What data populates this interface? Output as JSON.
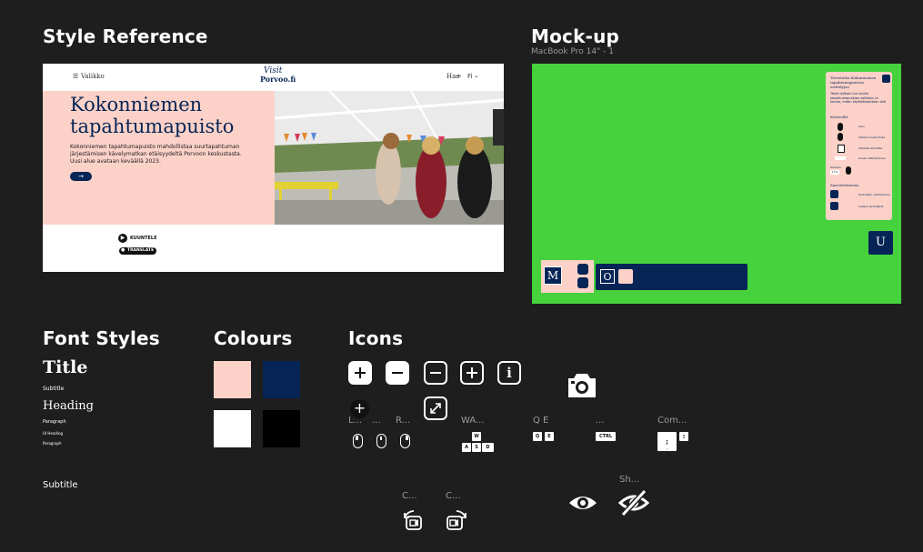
{
  "headings": {
    "style_reference": "Style Reference",
    "mockup": "Mock-up",
    "mockup_frame": "MacBook Pro 14\" - 1",
    "font_styles": "Font Styles",
    "colours": "Colours",
    "icons": "Icons"
  },
  "reference": {
    "menu_label": "Valikko",
    "logo_line1": "Visit",
    "logo_line2": "Porvoo.fi",
    "search_label": "Hae",
    "lang_label": "Fi",
    "hero_title_line1": "Kokonniemen",
    "hero_title_line2": "tapahtumapuisto",
    "hero_body": "Kokonniemen tapahtumapuisto mahdollistaa suurtapahtuman järjestämisen kävelymatkan etäisyydeltä Porvoon keskustasta. Uusi alue avataan keväällä 2023.",
    "listen_label": "KUUNTELE",
    "translate_label": "TRANSLATE"
  },
  "mockup": {
    "panel_title": "Tervetuloa Kokonniemen tapahtumapuiston esittelyyn!",
    "panel_body": "Tämä työkalu luo sinulle tapahtumapuiston esittelyn ja kertoo, miten käyttöönotetaan sitä",
    "section_controls": "Kontrollit",
    "control_rows": [
      "Liiku",
      "Vaihda kuvakulmaa",
      "Lähestä kohdetta",
      "Kuvan kääntyminen",
      "Kamera"
    ],
    "zoom_value": "17%",
    "section_access": "Saavutettavuus",
    "access_rows": [
      "Kontrastin vaihtaminen",
      "Lisätyt värimäärät"
    ],
    "button_m": "M",
    "button_o": "O",
    "button_u": "U"
  },
  "font_styles": {
    "title": "Title",
    "subtitle": "Subtitle",
    "heading": "Heading",
    "paragraph": "Paragraph",
    "ui_heading": "UI Heading",
    "paragraph_small": "Paragraph",
    "subtitle_large": "Subtitle"
  },
  "colours": {
    "swatches": [
      "#fcd2c8",
      "#062556",
      "#ffffff",
      "#000000"
    ]
  },
  "icons": {
    "label_left": "L...",
    "label_dots": "...",
    "label_right": "R...",
    "label_wasd": "WA...",
    "label_qe": "Q E",
    "label_ctrl_group": "...",
    "label_com": "Com...",
    "label_cam1": "C...",
    "label_cam2": "C...",
    "label_show": "Sh...",
    "key_w": "W",
    "key_a": "A",
    "key_s": "S",
    "key_d": "D",
    "key_q": "Q",
    "key_e": "E",
    "key_ctrl": "CTRL",
    "key_semicolon": ";",
    "key_colon": ":",
    "key_dot": "."
  }
}
